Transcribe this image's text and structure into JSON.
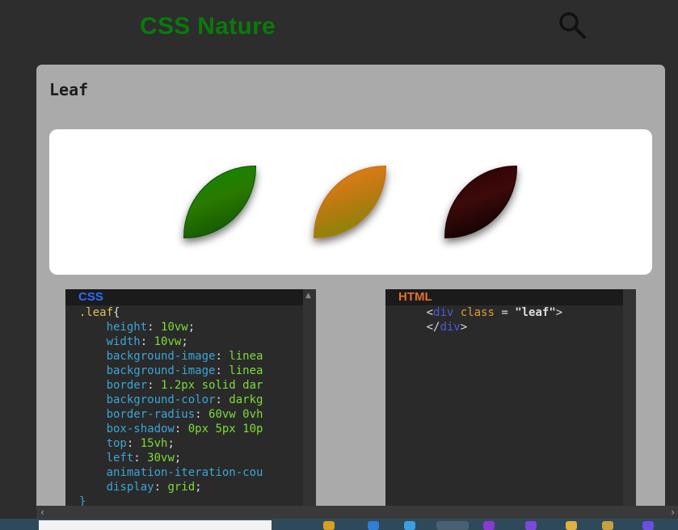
{
  "header": {
    "title": "CSS Nature"
  },
  "card": {
    "title": "Leaf"
  },
  "panels": {
    "css": {
      "label": "CSS",
      "lines": [
        {
          "indent": "  ",
          "parts": [
            [
              "sel",
              ".leaf"
            ],
            [
              "punct",
              "{"
            ]
          ]
        },
        {
          "indent": "      ",
          "parts": [
            [
              "prop",
              "height"
            ],
            [
              "punct",
              ": "
            ],
            [
              "val",
              "10vw"
            ],
            [
              "punct",
              ";"
            ]
          ]
        },
        {
          "indent": "      ",
          "parts": [
            [
              "prop",
              "width"
            ],
            [
              "punct",
              ": "
            ],
            [
              "val",
              "10vw"
            ],
            [
              "punct",
              ";"
            ]
          ]
        },
        {
          "indent": "      ",
          "parts": [
            [
              "prop",
              "background-image"
            ],
            [
              "punct",
              ": "
            ],
            [
              "val",
              "linea"
            ]
          ]
        },
        {
          "indent": "      ",
          "parts": [
            [
              "prop",
              "background-image"
            ],
            [
              "punct",
              ": "
            ],
            [
              "val",
              "linea"
            ]
          ]
        },
        {
          "indent": "      ",
          "parts": [
            [
              "prop",
              "border"
            ],
            [
              "punct",
              ": "
            ],
            [
              "val",
              "1.2px solid dar"
            ]
          ]
        },
        {
          "indent": "      ",
          "parts": [
            [
              "prop",
              "background-color"
            ],
            [
              "punct",
              ": "
            ],
            [
              "val",
              "darkg"
            ]
          ]
        },
        {
          "indent": "      ",
          "parts": [
            [
              "prop",
              "border-radius"
            ],
            [
              "punct",
              ": "
            ],
            [
              "val",
              "60vw 0vh"
            ]
          ]
        },
        {
          "indent": "      ",
          "parts": [
            [
              "prop",
              "box-shadow"
            ],
            [
              "punct",
              ": "
            ],
            [
              "val",
              "0px 5px 10p"
            ]
          ]
        },
        {
          "indent": "      ",
          "parts": [
            [
              "prop",
              "top"
            ],
            [
              "punct",
              ": "
            ],
            [
              "val",
              "15vh"
            ],
            [
              "punct",
              ";"
            ]
          ]
        },
        {
          "indent": "      ",
          "parts": [
            [
              "prop",
              "left"
            ],
            [
              "punct",
              ": "
            ],
            [
              "val",
              "30vw"
            ],
            [
              "punct",
              ";"
            ]
          ]
        },
        {
          "indent": "      ",
          "parts": [
            [
              "prop",
              "animation-iteration-cou"
            ]
          ]
        },
        {
          "indent": "      ",
          "parts": [
            [
              "prop",
              "display"
            ],
            [
              "punct",
              ": "
            ],
            [
              "val",
              "grid"
            ],
            [
              "punct",
              ";"
            ]
          ]
        },
        {
          "indent": "  ",
          "parts": [
            [
              "prop",
              "}"
            ]
          ]
        }
      ]
    },
    "html": {
      "label": "HTML",
      "lines": [
        {
          "indent": "      ",
          "parts": [
            [
              "punct",
              "<"
            ],
            [
              "tag",
              "div"
            ],
            [
              "punct",
              " "
            ],
            [
              "attr",
              "class"
            ],
            [
              "punct",
              " = "
            ],
            [
              "str",
              "\"leaf\""
            ],
            [
              "punct",
              ">"
            ]
          ]
        },
        {
          "indent": "      ",
          "parts": [
            [
              "punct",
              "</"
            ],
            [
              "tag",
              "div"
            ],
            [
              "punct",
              ">"
            ]
          ]
        }
      ]
    }
  },
  "colors": {
    "page_bg": "#2d2d2d",
    "title_green": "#0a7a0a",
    "card_bg": "#aaaaaa",
    "css_label": "#2c6cff",
    "html_label": "#e5702a"
  },
  "icons": {
    "search": "magnifier"
  }
}
